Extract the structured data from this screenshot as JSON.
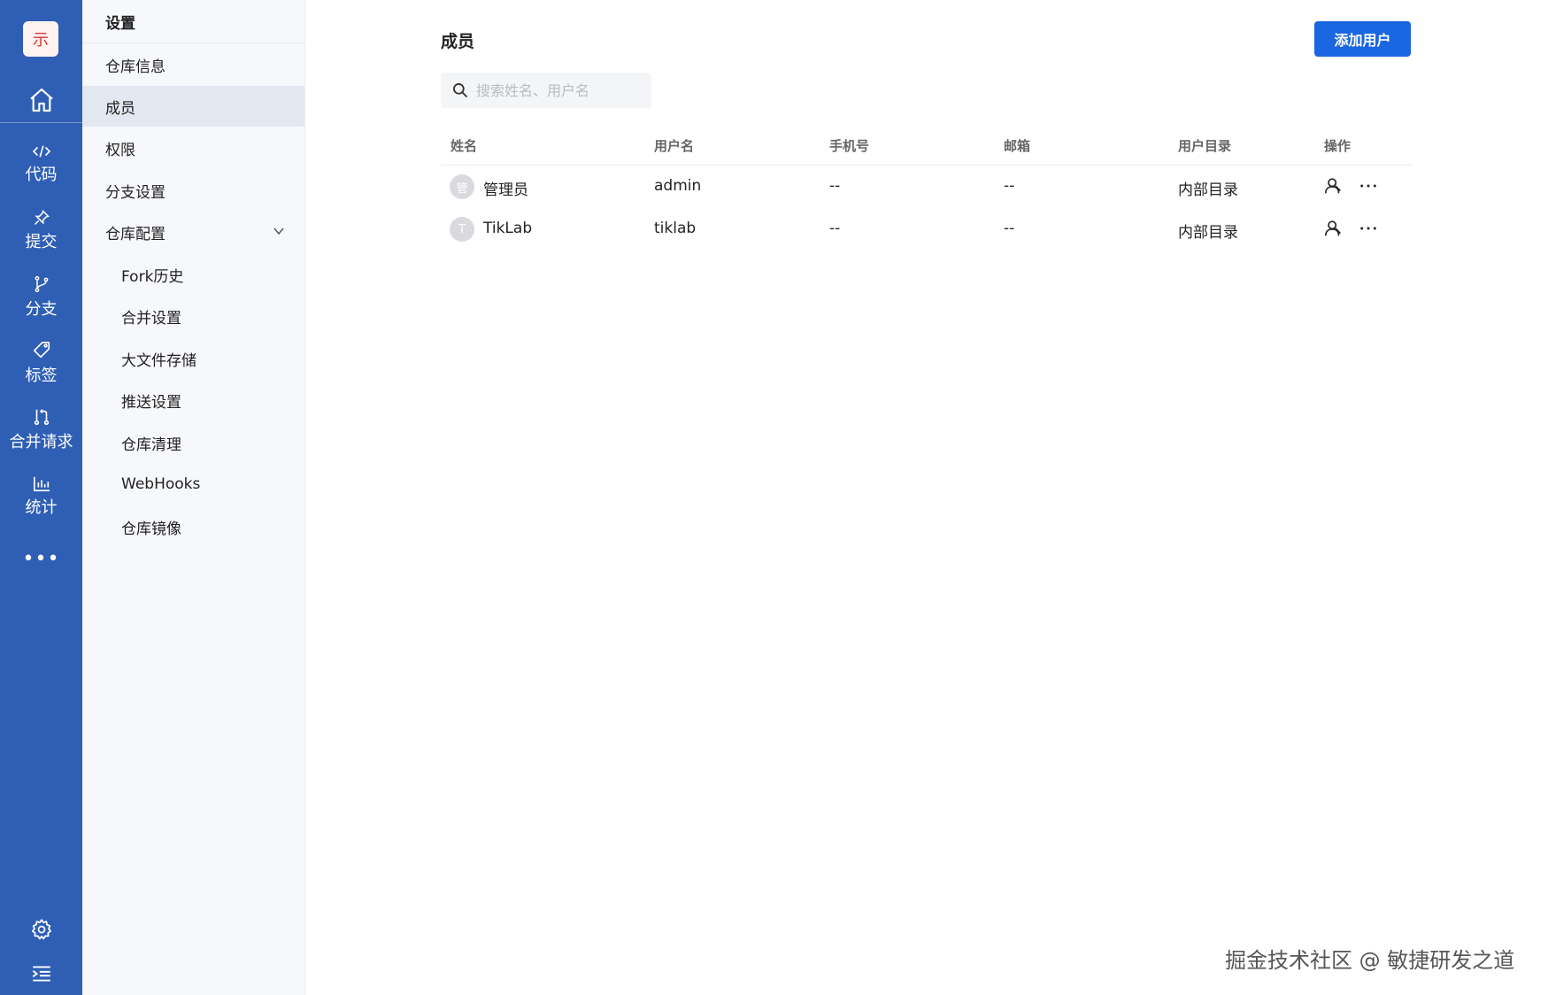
{
  "rail": {
    "logo_text": "示",
    "items": [
      {
        "label": "代码",
        "icon": "code-icon"
      },
      {
        "label": "提交",
        "icon": "pin-icon"
      },
      {
        "label": "分支",
        "icon": "branch-icon"
      },
      {
        "label": "标签",
        "icon": "tag-icon"
      },
      {
        "label": "合并请求",
        "icon": "merge-request-icon"
      },
      {
        "label": "统计",
        "icon": "chart-icon"
      }
    ],
    "more_label": "•••"
  },
  "menu": {
    "title": "设置",
    "items": [
      {
        "label": "仓库信息"
      },
      {
        "label": "成员",
        "active": true
      },
      {
        "label": "权限"
      },
      {
        "label": "分支设置"
      },
      {
        "label": "仓库配置",
        "expanded": true
      },
      {
        "label": "Fork历史"
      },
      {
        "label": "合并设置"
      },
      {
        "label": "大文件存储"
      },
      {
        "label": "推送设置"
      },
      {
        "label": "仓库清理"
      },
      {
        "label": "WebHooks"
      },
      {
        "label": "仓库镜像"
      }
    ]
  },
  "main": {
    "title": "成员",
    "add_button": "添加用户",
    "search_placeholder": "搜索姓名、用户名",
    "columns": [
      "姓名",
      "用户名",
      "手机号",
      "邮箱",
      "用户目录",
      "操作"
    ],
    "rows": [
      {
        "avatar": "管",
        "name": "管理员",
        "username": "admin",
        "phone": "--",
        "email": "--",
        "directory": "内部目录"
      },
      {
        "avatar": "T",
        "name": "TikLab",
        "username": "tiklab",
        "phone": "--",
        "email": "--",
        "directory": "内部目录"
      }
    ]
  },
  "watermark": "掘金技术社区 @ 敏捷研发之道",
  "colors": {
    "rail_bg": "#2f5fb5",
    "accent": "#1a66e0",
    "menu_bg": "#f7f8fb",
    "menu_active_bg": "#e3e8f0"
  }
}
